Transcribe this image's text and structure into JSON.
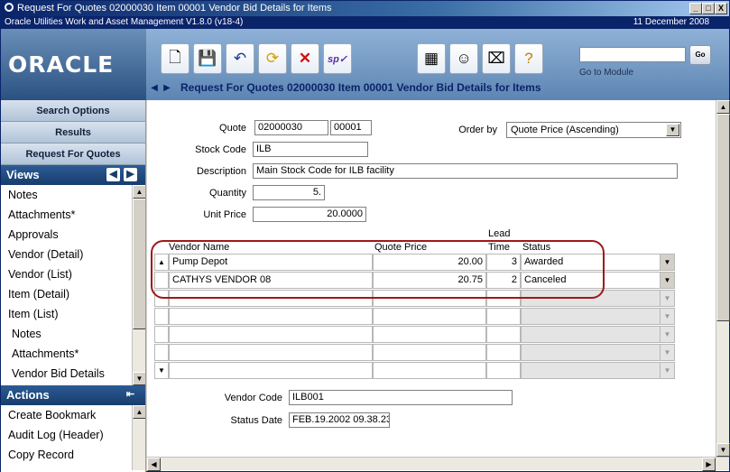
{
  "window": {
    "title": "Request For Quotes 02000030 Item 00001 Vendor Bid Details for Items",
    "app_name": "Oracle Utilities Work and Asset Management V1.8.0 (v18-4)",
    "date": "11 December  2008",
    "controls": [
      "_",
      "□",
      "X"
    ]
  },
  "logo": {
    "text": "ORACLE"
  },
  "toolbar": {
    "icons": [
      "new-icon",
      "save-icon",
      "undo-icon",
      "refresh-icon",
      "delete-icon",
      "spell-check-icon",
      "calculator-icon",
      "user-icon",
      "inbox-icon",
      "help-icon"
    ],
    "go_button": "Go",
    "goto_label": "Go to Module",
    "goto_value": ""
  },
  "page": {
    "title": "Request For Quotes 02000030 Item 00001 Vendor Bid Details for Items"
  },
  "left_nav": {
    "search_options": "Search Options",
    "results": "Results",
    "request_for_quotes": "Request For Quotes",
    "views_header": "Views",
    "views_items": [
      "Notes",
      "Attachments*",
      "Approvals",
      "Vendor (Detail)",
      "Vendor (List)",
      "Item (Detail)",
      "Item (List)",
      "Notes",
      "Attachments*",
      "Vendor Bid Details"
    ],
    "actions_header": "Actions",
    "actions_items": [
      "Create Bookmark",
      "Audit Log (Header)",
      "Copy Record"
    ]
  },
  "form": {
    "quote_label": "Quote",
    "quote_value": "02000030",
    "quote_item_value": "00001",
    "order_by_label": "Order by",
    "order_by_value": "Quote Price (Ascending)",
    "stock_code_label": "Stock Code",
    "stock_code_value": "ILB",
    "description_label": "Description",
    "description_value": "Main Stock Code for ILB facility",
    "quantity_label": "Quantity",
    "quantity_value": "5.",
    "unit_price_label": "Unit Price",
    "unit_price_value": "20.0000",
    "vendor_code_label": "Vendor Code",
    "vendor_code_value": "ILB001",
    "status_date_label": "Status Date",
    "status_date_value": "FEB.19.2002 09.38.23"
  },
  "grid": {
    "headers": {
      "vendor": "Vendor Name",
      "price": "Quote Price",
      "lead_top": "Lead",
      "lead": "Time",
      "status": "Status"
    },
    "rows": [
      {
        "vendor": "Pump Depot",
        "price": "20.00",
        "lead": "3",
        "status": "Awarded"
      },
      {
        "vendor": "CATHYS VENDOR 08",
        "price": "20.75",
        "lead": "2",
        "status": "Canceled"
      }
    ],
    "empty_rows": 5
  }
}
